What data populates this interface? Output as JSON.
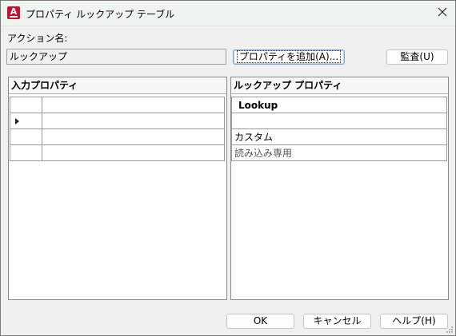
{
  "window": {
    "title": "プロパティ ルックアップ テーブル"
  },
  "action": {
    "label": "アクション名:",
    "value": "ルックアップ"
  },
  "buttons": {
    "add_property": "プロパティを追加(A)...",
    "audit": "監査(U)",
    "ok": "OK",
    "cancel": "キャンセル",
    "help": "ヘルプ(H)"
  },
  "input_panel": {
    "header": "入力プロパティ"
  },
  "lookup_panel": {
    "header": "ルックアップ プロパティ",
    "column_header": "Lookup",
    "rows": [
      "",
      "カスタム",
      "読み込み専用"
    ]
  },
  "colors": {
    "titlebar": "#eef4ee",
    "app_icon": "#c8102e",
    "default_button_border": "#7da3d6"
  },
  "icons": {
    "app": "autocad-icon",
    "close": "close-icon",
    "row_pointer": "row-pointer-icon",
    "resize": "resize-grip-icon"
  }
}
